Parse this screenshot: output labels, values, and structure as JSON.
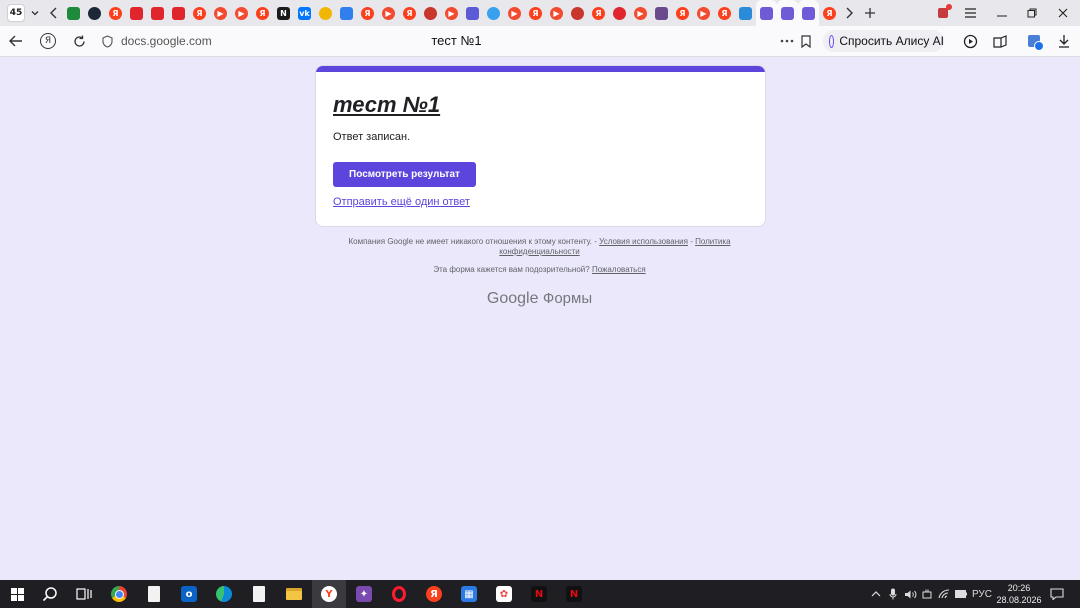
{
  "browser": {
    "tab_count": "45",
    "address": {
      "domain": "docs.google.com",
      "page_title": "тест №1"
    },
    "alice_button": "Спросить Алису AI",
    "tab_icons": [
      {
        "name": "tab-green-icon",
        "color": "#1e8a3c",
        "label": "",
        "shape": "sq"
      },
      {
        "name": "tab-steam-icon",
        "color": "#1b2838",
        "label": "",
        "shape": "round"
      },
      {
        "name": "tab-yandex-icon",
        "color": "#fc3f1d",
        "label": "Я",
        "shape": "round"
      },
      {
        "name": "tab-red-box-icon",
        "color": "#e0262c",
        "label": "",
        "shape": "sq"
      },
      {
        "name": "tab-red-box-icon",
        "color": "#e0262c",
        "label": "",
        "shape": "sq"
      },
      {
        "name": "tab-red-box-icon",
        "color": "#e0262c",
        "label": "",
        "shape": "sq"
      },
      {
        "name": "tab-yandex-icon",
        "color": "#fc3f1d",
        "label": "Я",
        "shape": "round"
      },
      {
        "name": "tab-play-icon",
        "color": "#f24b2f",
        "label": "▶",
        "shape": "round"
      },
      {
        "name": "tab-play-icon",
        "color": "#f24b2f",
        "label": "▶",
        "shape": "round"
      },
      {
        "name": "tab-yandex-icon",
        "color": "#fc3f1d",
        "label": "Я",
        "shape": "round"
      },
      {
        "name": "tab-netflix-icon",
        "color": "#1a1a1a",
        "label": "N",
        "shape": "sq"
      },
      {
        "name": "tab-vk-icon",
        "color": "#0077ff",
        "label": "vk",
        "shape": "sq"
      },
      {
        "name": "tab-gold-icon",
        "color": "#f2b705",
        "label": "",
        "shape": "round"
      },
      {
        "name": "tab-message-icon",
        "color": "#2f80ed",
        "label": "",
        "shape": "sq"
      },
      {
        "name": "tab-yandex-icon",
        "color": "#fc3f1d",
        "label": "Я",
        "shape": "round"
      },
      {
        "name": "tab-play-icon",
        "color": "#f24b2f",
        "label": "▶",
        "shape": "round"
      },
      {
        "name": "tab-yandex-icon",
        "color": "#fc3f1d",
        "label": "Я",
        "shape": "round"
      },
      {
        "name": "tab-avatar-icon",
        "color": "#c7372c",
        "label": "",
        "shape": "round"
      },
      {
        "name": "tab-play-icon",
        "color": "#f24b2f",
        "label": "▶",
        "shape": "round"
      },
      {
        "name": "tab-instagram-icon",
        "color": "#5b5bd6",
        "label": "",
        "shape": "sq"
      },
      {
        "name": "tab-apps-icon",
        "color": "#39a0ed",
        "label": "",
        "shape": "round"
      },
      {
        "name": "tab-play-icon",
        "color": "#f24b2f",
        "label": "▶",
        "shape": "round"
      },
      {
        "name": "tab-yandex-icon",
        "color": "#fc3f1d",
        "label": "Я",
        "shape": "round"
      },
      {
        "name": "tab-play-icon",
        "color": "#f24b2f",
        "label": "▶",
        "shape": "round"
      },
      {
        "name": "tab-avatar-icon",
        "color": "#c7372c",
        "label": "",
        "shape": "round"
      },
      {
        "name": "tab-yandex-icon",
        "color": "#fc3f1d",
        "label": "Я",
        "shape": "round"
      },
      {
        "name": "tab-pin-icon",
        "color": "#e0262c",
        "label": "",
        "shape": "round"
      },
      {
        "name": "tab-play-icon",
        "color": "#f24b2f",
        "label": "▶",
        "shape": "round"
      },
      {
        "name": "tab-photo-icon",
        "color": "#6a4a8c",
        "label": "",
        "shape": "sq"
      },
      {
        "name": "tab-yandex-icon",
        "color": "#fc3f1d",
        "label": "Я",
        "shape": "round"
      },
      {
        "name": "tab-play-icon",
        "color": "#f24b2f",
        "label": "▶",
        "shape": "round"
      },
      {
        "name": "tab-yandex-icon",
        "color": "#fc3f1d",
        "label": "Я",
        "shape": "round"
      },
      {
        "name": "tab-grid-icon",
        "color": "#2a8bd8",
        "label": "",
        "shape": "sq"
      },
      {
        "name": "tab-forms-icon",
        "color": "#6f5bd6",
        "label": "",
        "shape": "sq"
      },
      {
        "name": "tab-forms-icon",
        "color": "#6f5bd6",
        "label": "",
        "shape": "sq"
      },
      {
        "name": "tab-forms-icon",
        "color": "#6f5bd6",
        "label": "",
        "shape": "sq"
      },
      {
        "name": "tab-yandex-icon",
        "color": "#fc3f1d",
        "label": "Я",
        "shape": "round"
      }
    ]
  },
  "form": {
    "accent_color": "#5c45dd",
    "title": "тест №1",
    "confirmation": "Ответ записан.",
    "view_results_button": "Посмотреть результат",
    "another_response_link": "Отправить ещё один ответ",
    "disclaimer_text": "Компания Google не имеет никакого отношения к этому контенту. -",
    "terms_link": "Условия использования",
    "separator": "-",
    "privacy_link": "Политика конфиденциальности",
    "report_text": "Эта форма кажется вам подозрительной?",
    "report_link": "Пожаловаться",
    "logo_google": "Google",
    "logo_forms": "Формы"
  },
  "taskbar": {
    "language": "РУС",
    "time": "20:26",
    "date": "28.08.2026"
  }
}
